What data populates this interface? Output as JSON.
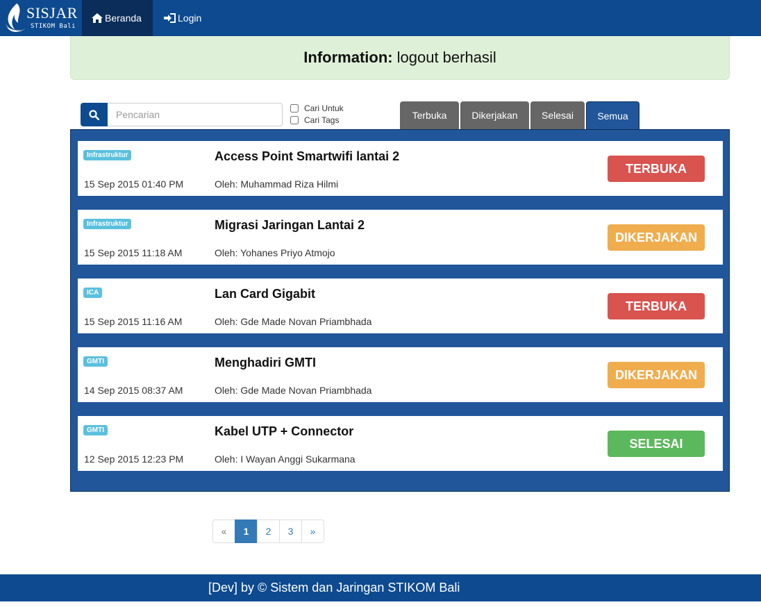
{
  "brand": {
    "title": "SISJAR",
    "subtitle": "STIKOM Bali"
  },
  "nav": {
    "home_label": "Beranda",
    "login_label": "Login"
  },
  "alert": {
    "label": "Information:",
    "message": "logout berhasil"
  },
  "search": {
    "placeholder": "Pencarian",
    "option_1": "Cari Untuk",
    "option_2": "Cari Tags"
  },
  "tabs": [
    {
      "label": "Terbuka",
      "active": false
    },
    {
      "label": "Dikerjakan",
      "active": false
    },
    {
      "label": "Selesai",
      "active": false
    },
    {
      "label": "Semua",
      "active": true
    }
  ],
  "tickets": [
    {
      "tag": "Infrastruktur",
      "date": "15 Sep 2015 01:40 PM",
      "title": "Access Point Smartwifi lantai 2",
      "author": "Oleh: Muhammad Riza Hilmi",
      "status": "TERBUKA",
      "status_color": "#d9534f"
    },
    {
      "tag": "Infrastruktur",
      "date": "15 Sep 2015 11:18 AM",
      "title": "Migrasi Jaringan Lantai 2",
      "author": "Oleh: Yohanes Priyo Atmojo",
      "status": "DIKERJAKAN",
      "status_color": "#f0ad4e"
    },
    {
      "tag": "ICA",
      "date": "15 Sep 2015 11:16 AM",
      "title": "Lan Card Gigabit",
      "author": "Oleh: Gde Made Novan Priambhada",
      "status": "TERBUKA",
      "status_color": "#d9534f"
    },
    {
      "tag": "GMTI",
      "date": "14 Sep 2015 08:37 AM",
      "title": "Menghadiri GMTI",
      "author": "Oleh: Gde Made Novan Priambhada",
      "status": "DIKERJAKAN",
      "status_color": "#f0ad4e"
    },
    {
      "tag": "GMTI",
      "date": "12 Sep 2015 12:23 PM",
      "title": "Kabel UTP + Connector",
      "author": "Oleh: I Wayan Anggi Sukarmana",
      "status": "SELESAI",
      "status_color": "#5cb85c"
    }
  ],
  "pagination": {
    "prev": "«",
    "pages": [
      "1",
      "2",
      "3"
    ],
    "current": "1",
    "next": "»"
  },
  "footer": {
    "text": "[Dev] by © Sistem dan Jaringan STIKOM Bali"
  },
  "colors": {
    "navbar": "#0d4a8f",
    "panel": "#21569a",
    "alert_bg": "#dff0d8",
    "badge": "#5bc0de"
  }
}
